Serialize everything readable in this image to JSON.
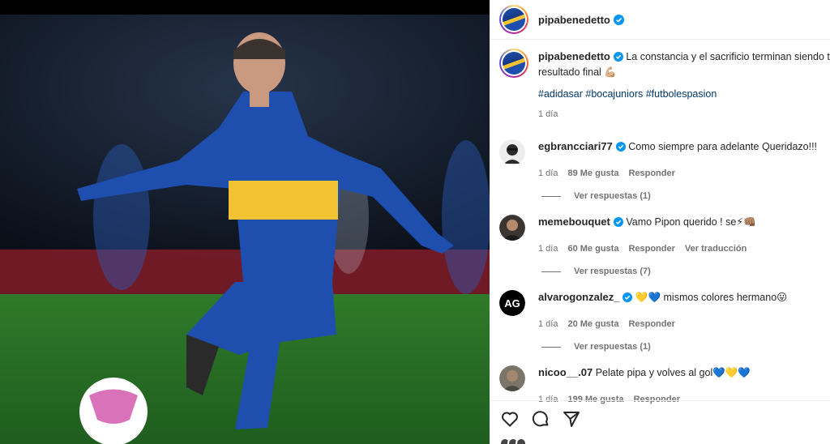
{
  "post": {
    "username": "pipabenedetto",
    "caption_username": "pipabenedetto",
    "caption_text": "La constancia y el sacrificio terminan siendo tu",
    "caption_text_2": "resultado final 💪🏼",
    "hashtags": "#adidasar #bocajuniors #futbolespasion",
    "time": "1 día"
  },
  "comments": [
    {
      "username": "egbrancciari77",
      "verified": true,
      "text": "Como siempre para adelante Queridazo!!!",
      "time": "1 día",
      "likes": "89 Me gusta",
      "reply": "Responder",
      "translate": "",
      "replies": "Ver respuestas (1)"
    },
    {
      "username": "memebouquet",
      "verified": true,
      "text": "Vamo Pipon querido ! se⚡👊🏽",
      "time": "1 día",
      "likes": "60 Me gusta",
      "reply": "Responder",
      "translate": "Ver traducción",
      "replies": "Ver respuestas (7)"
    },
    {
      "username": "alvarogonzalez_",
      "verified": true,
      "text": "💛💙 mismos colores hermano😛",
      "time": "1 día",
      "likes": "20 Me gusta",
      "reply": "Responder",
      "translate": "",
      "replies": "Ver respuestas (1)"
    },
    {
      "username": "nicoo__.07",
      "verified": false,
      "text": "Pelate pipa y volves al gol💙💛💙",
      "time": "1 día",
      "likes": "199 Me gusta",
      "reply": "Responder",
      "translate": "",
      "replies": ""
    }
  ],
  "icons": {
    "like": "heart-icon",
    "comment": "comment-icon",
    "share": "share-icon",
    "verified": "verified-badge-icon"
  },
  "colors": {
    "verified": "#0095f6",
    "link": "#00376b",
    "muted": "#737373",
    "boca_blue": "#1e4fae",
    "boca_gold": "#f1c232"
  }
}
